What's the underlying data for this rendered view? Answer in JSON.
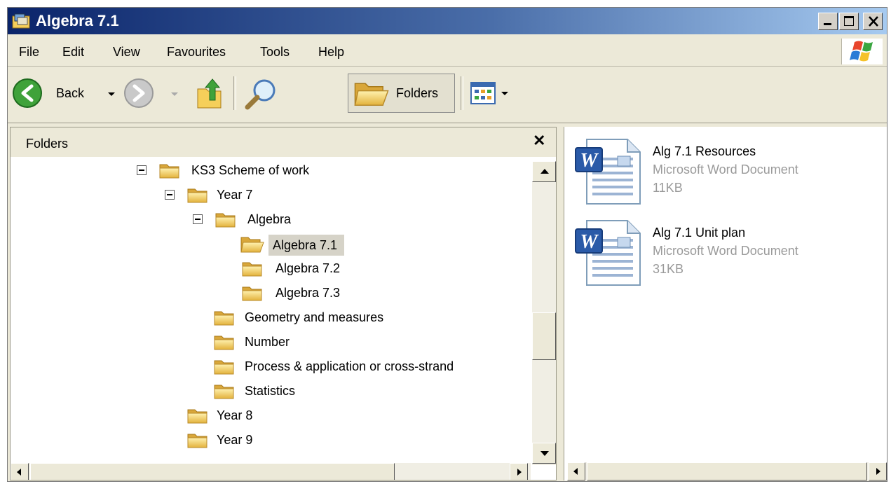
{
  "window": {
    "title": "Algebra 7.1",
    "title_icon": "explorer-folder-icon"
  },
  "menu": [
    "File",
    "Edit",
    "View",
    "Favourites",
    "Tools",
    "Help"
  ],
  "toolbar": {
    "back_label": "Back",
    "folders_label": "Folders"
  },
  "pane": {
    "title": "Folders",
    "close": "✕"
  },
  "tree": [
    {
      "label": "KS3 Scheme of work",
      "expanded": true
    },
    {
      "label": "Year 7",
      "expanded": true
    },
    {
      "label": "Algebra",
      "expanded": true
    },
    {
      "label": "Algebra 7.1",
      "selected": true,
      "open": true
    },
    {
      "label": "Algebra 7.2"
    },
    {
      "label": "Algebra 7.3"
    },
    {
      "label": "Geometry and measures"
    },
    {
      "label": "Number"
    },
    {
      "label": "Process & application or cross-strand"
    },
    {
      "label": "Statistics"
    },
    {
      "label": "Year 8"
    },
    {
      "label": "Year 9"
    }
  ],
  "files": [
    {
      "name": "Alg 7.1 Resources",
      "type": "Microsoft Word Document",
      "size": "11KB",
      "icon": "word-document-icon"
    },
    {
      "name": "Alg 7.1 Unit plan",
      "type": "Microsoft Word Document",
      "size": "31KB",
      "icon": "word-document-icon"
    }
  ],
  "colors": {
    "titlebar_start": "#0a246a",
    "titlebar_end": "#a6caf0",
    "chrome": "#ece9d8",
    "selection": "#d6d3c8",
    "folder_yellow": "#f5cf5a"
  }
}
